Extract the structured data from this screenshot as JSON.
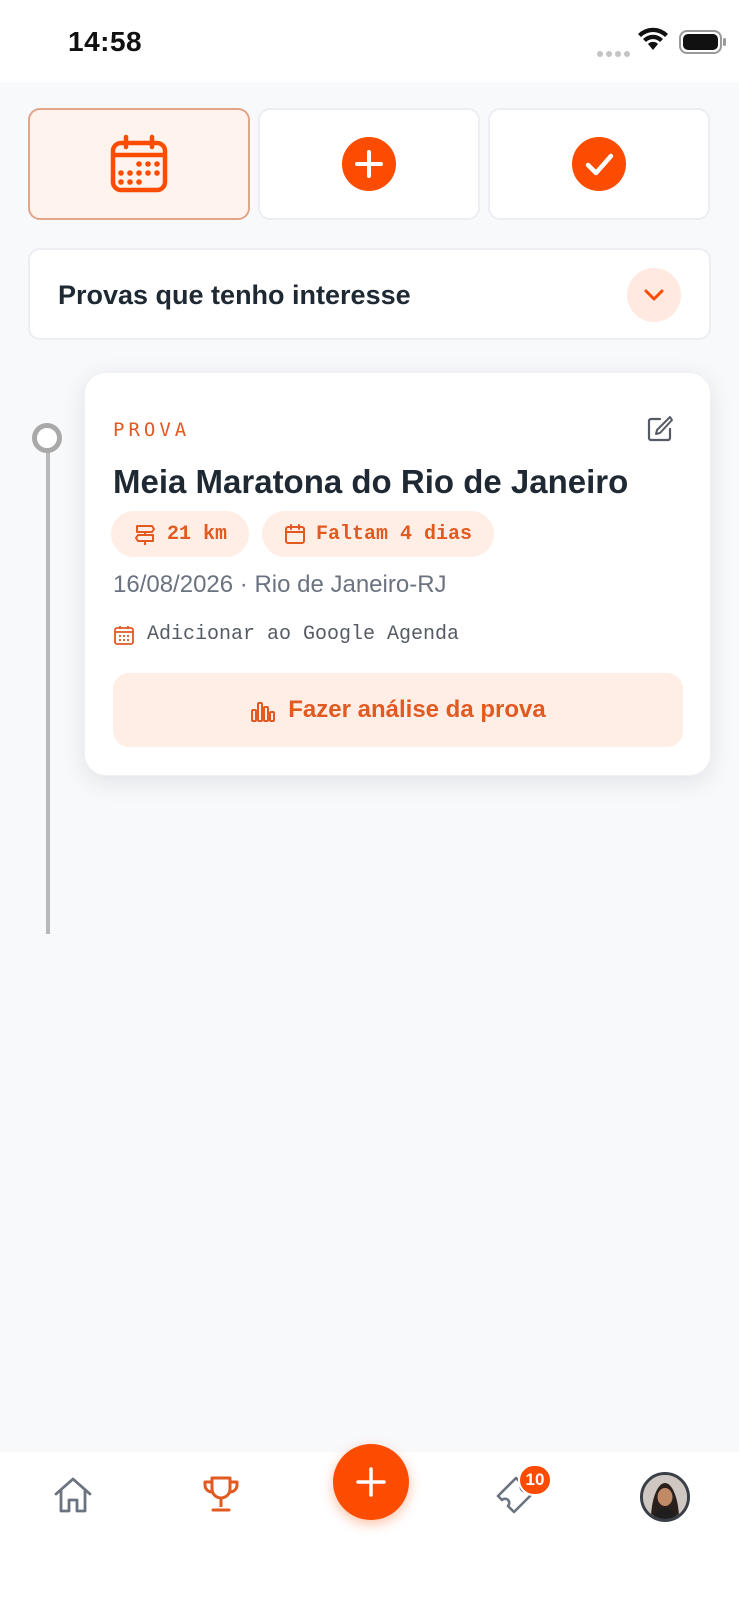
{
  "status_bar": {
    "time": "14:58"
  },
  "view_tabs": [
    {
      "name": "calendar",
      "icon": "calendar-icon",
      "active": true
    },
    {
      "name": "add",
      "icon": "plus-circle-icon",
      "active": false
    },
    {
      "name": "completed",
      "icon": "check-circle-icon",
      "active": false
    }
  ],
  "filter": {
    "label": "Provas que tenho interesse",
    "icon": "chevron-down-icon"
  },
  "event": {
    "kind_label": "PROVA",
    "title": "Meia Maratona do Rio de Janeiro",
    "distance": "21 km",
    "countdown": "Faltam 4 dias",
    "meta": "16/08/2026 · Rio de Janeiro-RJ",
    "calendar_link": "Adicionar ao Google Agenda",
    "analyze_label": "Fazer análise da prova"
  },
  "bottom_nav": {
    "items": [
      "home-icon",
      "trophy-icon",
      "plus-icon",
      "ticket-icon",
      "avatar"
    ],
    "active": "trophy-icon",
    "ticket_badge": "10"
  },
  "colors": {
    "accent": "#fc4c02",
    "accent_text": "#e05a22",
    "accent_soft": "#ffeee6",
    "background": "#f8f9fb"
  }
}
